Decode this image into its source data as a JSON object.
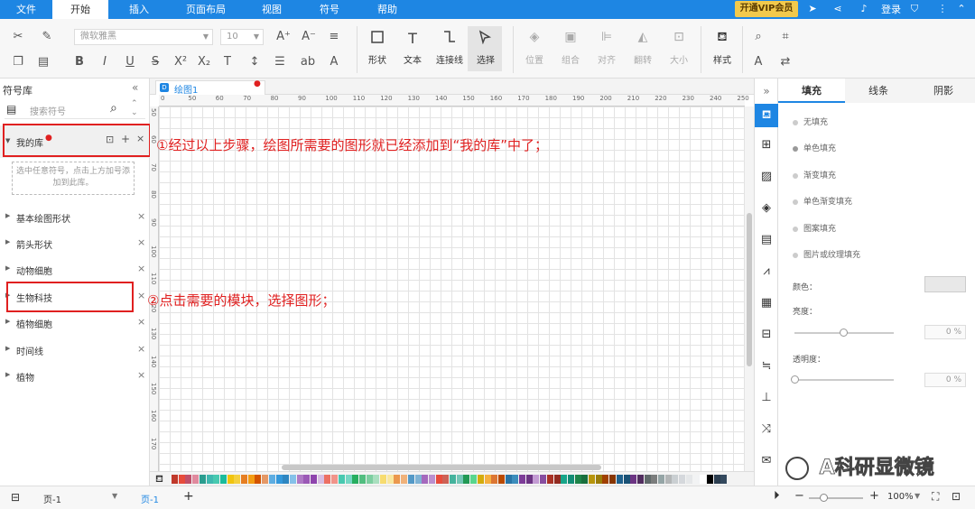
{
  "menubar": {
    "items": [
      "文件",
      "开始",
      "插入",
      "页面布局",
      "视图",
      "符号",
      "帮助"
    ],
    "vip": "开通VIP会员",
    "login": "登录"
  },
  "ribbon": {
    "font_name": "微软雅黑",
    "font_size": "10",
    "groups": {
      "shape": "形状",
      "text": "文本",
      "connector": "连接线",
      "select": "选择",
      "position": "位置",
      "group": "组合",
      "align": "对齐",
      "flip": "翻转",
      "size": "大小",
      "style": "样式"
    },
    "format_glyphs": {
      "bold": "B",
      "italic": "I",
      "underline": "U",
      "strike": "S",
      "sup": "X²",
      "sub": "X₂",
      "tt": "T",
      "spacing": "↕",
      "list": "☰",
      "ab": "ab",
      "a": "A"
    }
  },
  "sidebar": {
    "title": "符号库",
    "search_placeholder": "搜索符号",
    "my_library": "我的库",
    "hint": "选中任意符号，点击上方加号添加到此库。",
    "libraries": [
      "基本绘图形状",
      "箭头形状",
      "动物细胞",
      "生物科技",
      "植物细胞",
      "时间线",
      "植物"
    ]
  },
  "document": {
    "tab": "绘图1",
    "ruler_h": [
      "0",
      "50",
      "60",
      "70",
      "80",
      "90",
      "100",
      "110",
      "120",
      "130",
      "140",
      "150",
      "160",
      "170",
      "180",
      "190",
      "200",
      "210",
      "220",
      "230",
      "240",
      "250"
    ],
    "ruler_v": [
      "50",
      "60",
      "70",
      "80",
      "90",
      "100",
      "110",
      "120",
      "130",
      "140",
      "150",
      "160",
      "170"
    ]
  },
  "annotations": {
    "step1": "①经过以上步骤，绘图所需要的图形就已经添加到“我的库”中了；",
    "step2": "②点击需要的模块，选择图形；"
  },
  "palette": [
    "#c0392b",
    "#e74c3c",
    "#c0506a",
    "#e08a9e",
    "#2a9d8f",
    "#3fb8af",
    "#48c9b0",
    "#1abc9c",
    "#f1c40f",
    "#f4d03f",
    "#e67e22",
    "#f39c12",
    "#d35400",
    "#e59866",
    "#5dade2",
    "#3498db",
    "#2e86c1",
    "#85c1e9",
    "#af7ac5",
    "#9b59b6",
    "#8e44ad",
    "#d7bde2",
    "#ec7063",
    "#f1948a",
    "#48c9b0",
    "#76d7c4",
    "#27ae60",
    "#52be80",
    "#7dcea0",
    "#a9dfbf",
    "#f7dc6f",
    "#f9e79f",
    "#eb984e",
    "#f0b27a",
    "#5499c7",
    "#7fb3d5",
    "#a569bd",
    "#bb8fce",
    "#e74c3c",
    "#cd6155",
    "#45b39d",
    "#73c6b6",
    "#229954",
    "#58d68d",
    "#d4ac0d",
    "#f5b041",
    "#dc7633",
    "#ba4a00",
    "#2874a6",
    "#3c8dbc",
    "#7d3c98",
    "#6c3483",
    "#c39bd3",
    "#884ea0",
    "#a93226",
    "#922b21",
    "#17a589",
    "#138d75",
    "#1e8449",
    "#196f3d",
    "#b7950b",
    "#9a7d0a",
    "#a04000",
    "#873600",
    "#1f618d",
    "#1a5276",
    "#6c3483",
    "#512e5f",
    "#616a6b",
    "#7b7d7d",
    "#95a5a6",
    "#b3b6b7",
    "#cacfd2",
    "#d5d8dc",
    "#e5e7e9",
    "#f2f3f4",
    "#ffffff",
    "#000000",
    "#2c3e50",
    "#34495e"
  ],
  "right_panel": {
    "tabs": [
      "填充",
      "线条",
      "阴影"
    ],
    "fill_options": [
      "无填充",
      "单色填充",
      "渐变填充",
      "单色渐变填充",
      "图案填充",
      "图片或纹理填充"
    ],
    "color_label": "颜色：",
    "brightness_label": "亮度：",
    "brightness_value": "0 %",
    "opacity_label": "透明度：",
    "opacity_value": "0 %",
    "collapse": "»"
  },
  "statusbar": {
    "page_select": "页-1",
    "page_tab": "页-1",
    "add": "+",
    "zoom": "100%",
    "zoom_minus": "−",
    "zoom_plus": "+"
  },
  "watermark": "A科研显微镜"
}
